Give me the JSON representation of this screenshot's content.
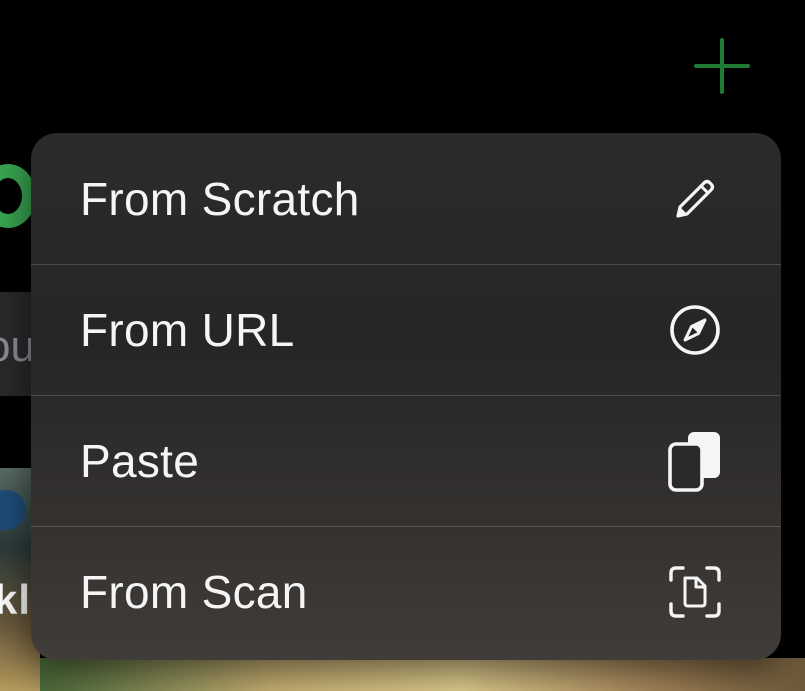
{
  "header": {
    "add_button_icon": "plus-icon",
    "accent_color": "#1f7a34"
  },
  "menu": {
    "items": [
      {
        "label": "From Scratch",
        "icon": "pencil-icon"
      },
      {
        "label": "From URL",
        "icon": "compass-icon"
      },
      {
        "label": "Paste",
        "icon": "clipboard-icon"
      },
      {
        "label": "From Scan",
        "icon": "document-scan-icon"
      }
    ]
  },
  "background": {
    "title_fragment": "",
    "search_fragment": "ou",
    "card_fragment": "kl"
  }
}
